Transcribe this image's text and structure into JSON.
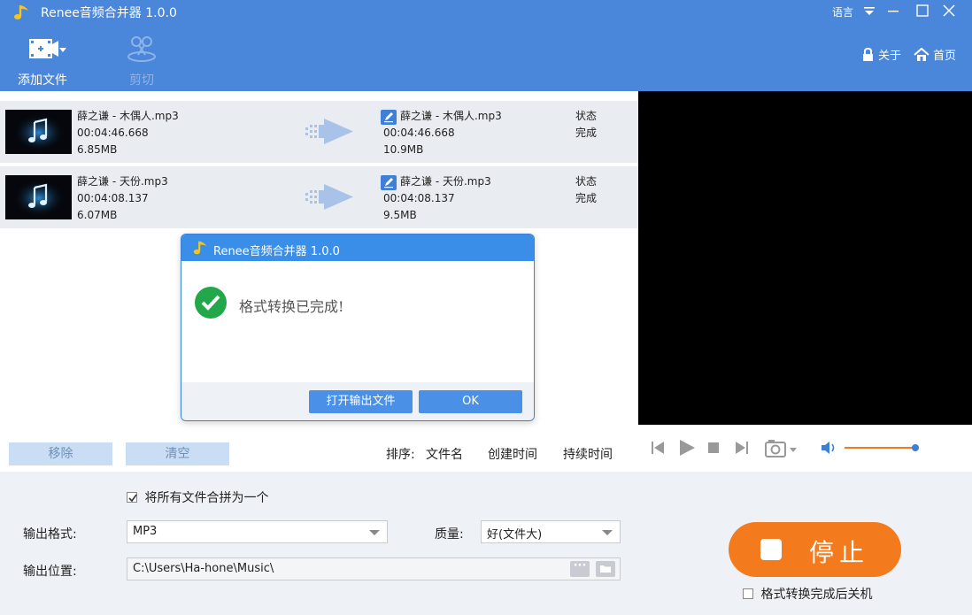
{
  "app": {
    "title": "Renee音频合并器 1.0.0",
    "language": "语言"
  },
  "toolbar": {
    "add_file": "添加文件",
    "cut": "剪切",
    "about": "关于",
    "home": "首页"
  },
  "files": [
    {
      "src_name": "薛之谦 - 木偶人.mp3",
      "src_duration": "00:04:46.668",
      "src_size": "6.85MB",
      "out_name": "薛之谦 - 木偶人.mp3",
      "out_duration": "00:04:46.668",
      "out_size": "10.9MB",
      "status_label": "状态",
      "status": "完成"
    },
    {
      "src_name": "薛之谦 - 天份.mp3",
      "src_duration": "00:04:08.137",
      "src_size": "6.07MB",
      "out_name": "薛之谦 - 天份.mp3",
      "out_duration": "00:04:08.137",
      "out_size": "9.5MB",
      "status_label": "状态",
      "status": "完成"
    }
  ],
  "list_bar": {
    "remove": "移除",
    "clear": "清空",
    "sort_label": "排序:",
    "sort_name": "文件名",
    "sort_created": "创建时间",
    "sort_duration": "持续时间"
  },
  "settings": {
    "merge_all": "将所有文件合拼为一个",
    "format_label": "输出格式:",
    "format_value": "MP3",
    "quality_label": "质量:",
    "quality_value": "好(文件大)",
    "location_label": "输出位置:",
    "location_value": "C:\\Users\\Ha-hone\\Music\\",
    "stop": "停止",
    "shutdown": "格式转换完成后关机"
  },
  "dialog": {
    "title": "Renee音频合并器 1.0.0",
    "message": "格式转换已完成!",
    "open_output": "打开输出文件",
    "ok": "OK"
  },
  "player": {
    "volume": 0.98
  },
  "colors": {
    "header": "#4a86d9",
    "accent": "#f47a1e",
    "success": "#22a84a"
  }
}
